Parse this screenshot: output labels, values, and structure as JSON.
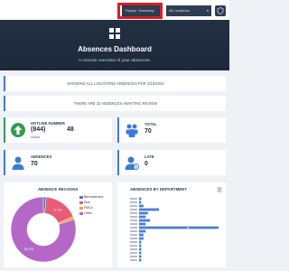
{
  "topbar": {
    "range_label": "Range: Yesterday",
    "location_label": "All Locations"
  },
  "hero": {
    "title": "Absences Dashboard",
    "subtitle": "A concise overview of your absences."
  },
  "banner1": "SHOWING ALL LOCATIONS ABSENCES FOR 3/10/2023",
  "banner2": "THERE ARE 32 ABSENCES AWAITING REVIEW",
  "hotline": {
    "label": "HOTLINE NUMBER",
    "number": "(844)",
    "count": "48",
    "status": "Active"
  },
  "total": {
    "label": "TOTAL",
    "value": "70"
  },
  "absences": {
    "label": "ABSENCES",
    "value": "70"
  },
  "late": {
    "label": "LATE",
    "value": "0"
  },
  "colors": {
    "accent": "#3a7bd5",
    "navy": "#1f2d3e",
    "highlight": "#e01a22",
    "green": "#2e9e4f"
  },
  "charts": {
    "reasons_title": "ABSENCE REASONS",
    "dept_title": "ABSENCES BY DEPARTMENT"
  },
  "chart_data": [
    {
      "type": "pie",
      "title": "ABSENCE REASONS",
      "categories": [
        "Bereavement",
        "Sick",
        "FMLA",
        "Other"
      ],
      "values": [
        1.4,
        17.1,
        1.4,
        80.0
      ],
      "colors": [
        "#4a78c2",
        "#e85c7a",
        "#f0a23c",
        "#b567c7"
      ],
      "slice_labels": [
        "",
        "17.1%",
        "",
        "80.0%"
      ],
      "legend": "top-right"
    },
    {
      "type": "bar",
      "orientation": "horizontal",
      "title": "ABSENCES BY DEPARTMENT",
      "categories": [
        "",
        "",
        "",
        "",
        "",
        "",
        "",
        "",
        "",
        "",
        "",
        "",
        "",
        "",
        "",
        "",
        "",
        ""
      ],
      "values": [
        1,
        1,
        2,
        9,
        4,
        3,
        5,
        3,
        36,
        3,
        2,
        2,
        1,
        1,
        1,
        1,
        1,
        1
      ],
      "value_labels": [
        "",
        "",
        "",
        "",
        "",
        "",
        "",
        "",
        "36",
        "",
        "",
        "",
        "",
        "",
        "",
        "",
        "",
        ""
      ],
      "color": "#4a7fd4"
    }
  ]
}
